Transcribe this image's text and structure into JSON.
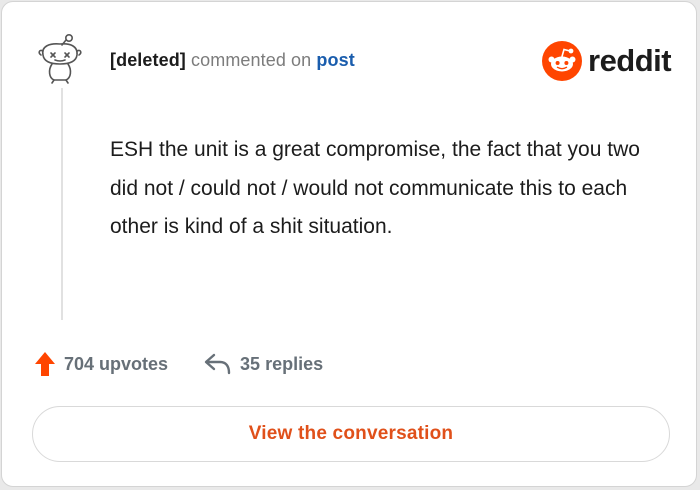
{
  "header": {
    "author": "[deleted]",
    "action": "commented on",
    "post_link": "post"
  },
  "brand": {
    "name": "reddit",
    "logo_icon": "reddit-alien-icon",
    "color": "#ff4500"
  },
  "comment": {
    "text": "ESH the unit is a great compromise, the fact that you two did not / could not / would not communicate this to each other is kind of a shit situation."
  },
  "stats": {
    "upvotes_label": "704 upvotes",
    "upvote_icon": "upvote-arrow-icon",
    "upvote_color": "#ff4500",
    "replies_label": "35 replies",
    "reply_icon": "reply-arrow-icon"
  },
  "cta": {
    "label": "View the conversation",
    "color": "#e0501a"
  }
}
